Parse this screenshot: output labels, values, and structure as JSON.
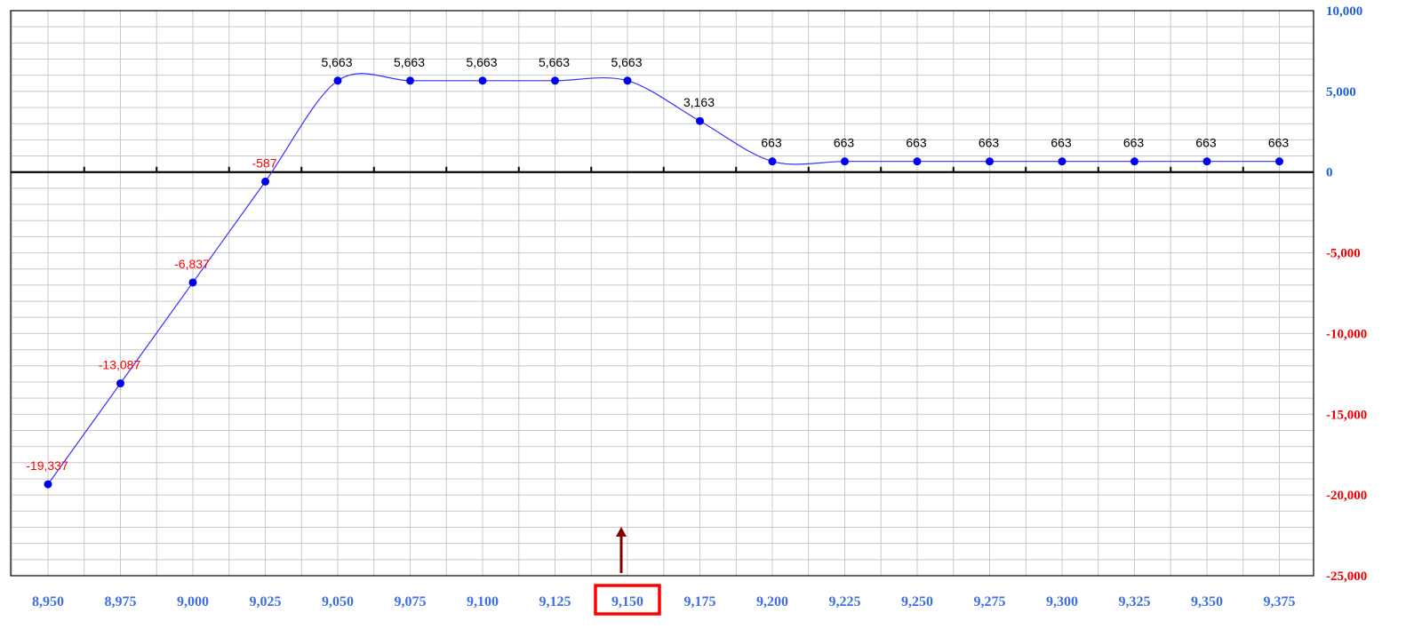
{
  "chart_data": {
    "type": "line",
    "x": [
      8950,
      8975,
      9000,
      9025,
      9050,
      9075,
      9100,
      9125,
      9150,
      9175,
      9200,
      9225,
      9250,
      9275,
      9300,
      9325,
      9350,
      9375
    ],
    "x_tick_labels": [
      "8,950",
      "8,975",
      "9,000",
      "9,025",
      "9,050",
      "9,075",
      "9,100",
      "9,125",
      "9,150",
      "9,175",
      "9,200",
      "9,225",
      "9,250",
      "9,275",
      "9,300",
      "9,325",
      "9,350",
      "9,375"
    ],
    "series": [
      {
        "values": [
          -19337,
          -13087,
          -6837,
          -587,
          5663,
          5663,
          5663,
          5663,
          5663,
          3163,
          663,
          663,
          663,
          663,
          663,
          663,
          663,
          663
        ],
        "data_labels": [
          "-19,337",
          "-13,087",
          "-6,837",
          "-587",
          "5,663",
          "5,663",
          "5,663",
          "5,663",
          "5,663",
          "3,163",
          "663",
          "663",
          "663",
          "663",
          "663",
          "663",
          "663",
          "663"
        ]
      }
    ],
    "ylim": [
      -25000,
      10000
    ],
    "y_ticks": [
      10000,
      5000,
      0,
      -5000,
      -10000,
      -15000,
      -20000,
      -25000
    ],
    "y_tick_labels": [
      "10,000",
      "5,000",
      "0",
      "-5,000",
      "-10,000",
      "-15,000",
      "-20,000",
      "-25,000"
    ],
    "highlighted_x": "9,150",
    "grid": true,
    "y_axis_side": "right",
    "title": "",
    "xlabel": "",
    "ylabel": "",
    "colors": {
      "line": "#3333ff",
      "marker": "#0000ee",
      "positive_label": "#000000",
      "negative_label": "#ff0000",
      "x_tick": "#3f6fe0",
      "y_tick_positive": "#1f5fd8",
      "y_tick_negative": "#ee0000",
      "highlight_box": "#ff0000",
      "arrow": "#800000",
      "grid": "#c8c8c8",
      "zero_line": "#000000"
    }
  }
}
